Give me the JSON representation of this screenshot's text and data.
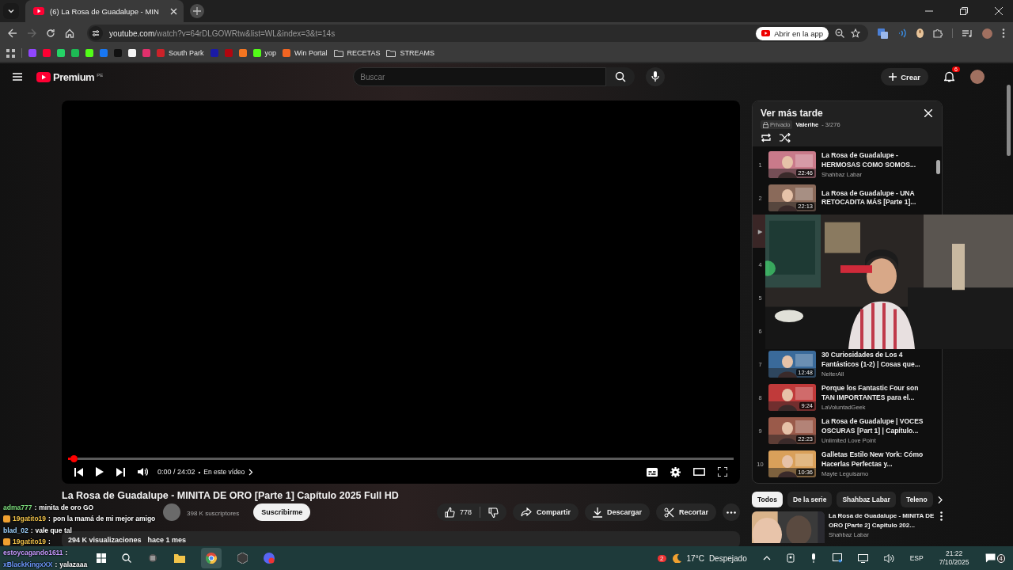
{
  "browser": {
    "tab": {
      "title": "(6) La Rosa de Guadalupe - MIN"
    },
    "address": {
      "host": "youtube.com",
      "path": "/watch?v=64rDLGOWRtw&list=WL&index=3&t=14s"
    },
    "open_app": "Abrir en la app",
    "bookmarks": [
      {
        "kind": "icon",
        "color": "#9146ff"
      },
      {
        "kind": "icon",
        "color": "#ff0033"
      },
      {
        "kind": "icon",
        "color": "#25d366"
      },
      {
        "kind": "icon",
        "color": "#1db954"
      },
      {
        "kind": "icon",
        "color": "#53fc18"
      },
      {
        "kind": "icon",
        "color": "#1877f2"
      },
      {
        "kind": "icon",
        "color": "#111111"
      },
      {
        "kind": "icon",
        "color": "#f5f5f5"
      },
      {
        "kind": "icon",
        "color": "#e1306c"
      },
      {
        "kind": "icon",
        "color": "#cc2229",
        "label": "South Park"
      },
      {
        "kind": "icon",
        "color": "#1a1aa6"
      },
      {
        "kind": "icon",
        "color": "#b1060f"
      },
      {
        "kind": "icon",
        "color": "#f47521"
      },
      {
        "kind": "icon",
        "color": "#53fc18",
        "label": "yop"
      },
      {
        "kind": "icon",
        "color": "#f26522",
        "label": "Win Portal"
      },
      {
        "kind": "folder",
        "label": "RECETAS"
      },
      {
        "kind": "folder",
        "label": "STREAMS"
      }
    ]
  },
  "youtube": {
    "logo": "Premium",
    "region": "PE",
    "search": {
      "placeholder": "Buscar"
    },
    "create": "Crear",
    "notifications": "6",
    "player": {
      "time": "0:00 / 24:02",
      "separator": "•",
      "chapter": "En este vídeo",
      "level": 0.004
    },
    "video": {
      "title": "La Rosa de Guadalupe - MINITA DE ORO [Parte 1] Capítulo 2025 Full HD",
      "subscribers": "398 K suscriptores",
      "subscribe": "Suscribirme",
      "likes": "778",
      "actions": [
        {
          "kind": "share",
          "label": "Compartir"
        },
        {
          "kind": "download",
          "label": "Descargar"
        },
        {
          "kind": "clip",
          "label": "Recortar"
        }
      ],
      "views": "294 K visualizaciones",
      "age": "hace 1 mes"
    },
    "playlist": {
      "title": "Ver más tarde",
      "privacy": "Privado",
      "owner": "Valerihe",
      "position": "- 3/276",
      "items": [
        {
          "index": "1",
          "title": "La Rosa de Guadalupe - HERMOSAS COMO SOMOS...",
          "channel": "Shahbaz Labar",
          "duration": "22:46",
          "selected": false
        },
        {
          "index": "2",
          "title": "La Rosa de Guadalupe - UNA RETOCADITA MÁS [Parte 1]...",
          "duration": "22:13",
          "selected": false
        },
        {
          "index": "▶",
          "selected": true
        },
        {
          "index": "4",
          "selected": false
        },
        {
          "index": "5",
          "selected": false
        },
        {
          "index": "6",
          "selected": false
        },
        {
          "index": "7",
          "title": "30 Curiosidades de Los 4 Fantásticos (1-2) | Cosas que...",
          "channel": "NeiterAll",
          "duration": "12:48",
          "selected": false
        },
        {
          "index": "8",
          "title": "Porque los Fantastic Four son TAN IMPORTANTES para el...",
          "channel": "LaVoluntadGeek",
          "duration": "9:24",
          "selected": false
        },
        {
          "index": "9",
          "title": "La Rosa de Guadalupe | VOCES OSCURAS [Part 1] | Capítulo...",
          "channel": "Unlimited Love Point",
          "duration": "22:23",
          "selected": false
        },
        {
          "index": "10",
          "title": "Galletas Estilo New York: Cómo Hacerlas Perfectas y...",
          "channel": "Mayte Leguisamo",
          "duration": "10:36",
          "selected": false
        }
      ]
    },
    "chips": [
      {
        "label": "Todos",
        "selected": true
      },
      {
        "label": "De la serie",
        "selected": false
      },
      {
        "label": "Shahbaz Labar",
        "selected": false
      },
      {
        "label": "Teleno",
        "selected": false
      }
    ],
    "related": {
      "title": "La Rosa de Guadalupe - MINITA DE ORO [Parte 2] Capitulo 202...",
      "channel": "Shahbaz Labar"
    }
  },
  "chat": [
    {
      "user": "adma777",
      "color": "#7ee07e",
      "separator": ":",
      "message": "minita de oro GO",
      "kind": "plain"
    },
    {
      "user": "19gatito19",
      "color": "#f0c24a",
      "separator": ":",
      "message": "pon la mamá de mi mejor amigo",
      "kind": "badged"
    },
    {
      "user": "blad_02",
      "color": "#9fd3ff",
      "separator": ":",
      "message": "vale que tal",
      "kind": "plain"
    },
    {
      "user": "19gatito19",
      "color": "#f0c24a",
      "separator": ":",
      "kind": "badged"
    },
    {
      "user": "estoycagando1611",
      "color": "#c79bff",
      "separator": ":",
      "kind": "plain"
    },
    {
      "user": "xBlackKingxXX",
      "color": "#6f9bff",
      "separator": ":",
      "message": "yalazaaa",
      "kind": "plain"
    }
  ],
  "taskbar": {
    "weather_badge": "2",
    "temperature": "17°C",
    "condition": "Despejado",
    "language": "ESP",
    "time": "21:22",
    "date": "7/10/2025",
    "notifications": "4"
  }
}
